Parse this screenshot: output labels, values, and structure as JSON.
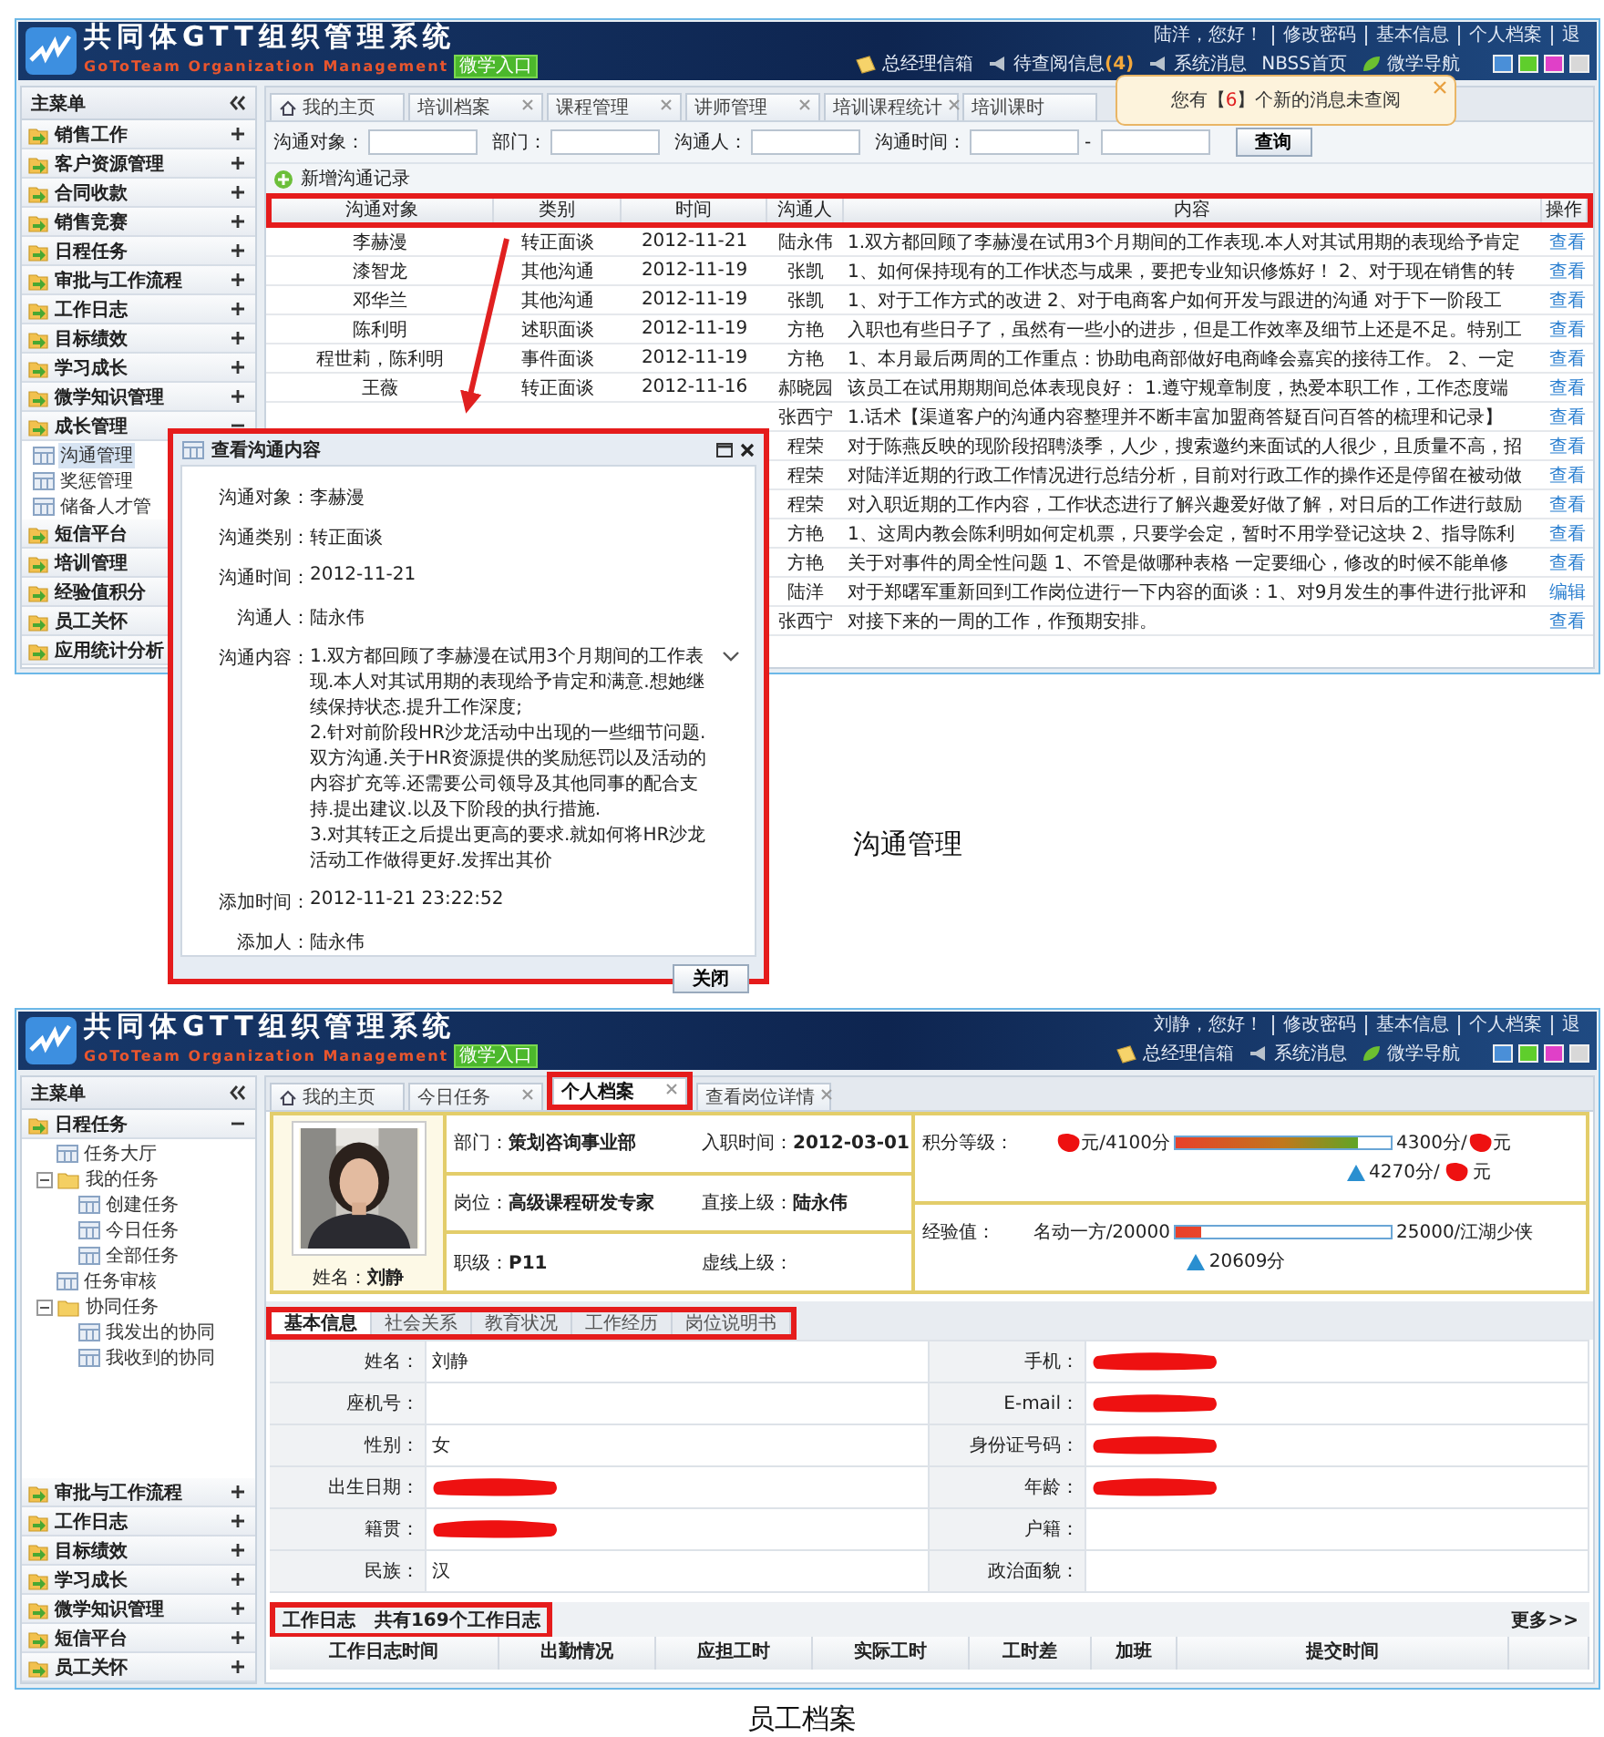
{
  "communication": {
    "caption": "沟通管理",
    "header": {
      "title": "共同体GTT组织管理系统",
      "subtitle": "GoToTeam Organization Management",
      "badge": "微学入口",
      "user_links": [
        "陆洋，您好！",
        "修改密码",
        "基本信息",
        "个人档案",
        "退"
      ],
      "tools": [
        {
          "kind": "mail",
          "label": "总经理信箱"
        },
        {
          "kind": "notice",
          "label": "待查阅信息",
          "count": "(4)"
        },
        {
          "kind": "system",
          "label": "系统消息"
        },
        {
          "kind": "link",
          "label": "NBSS首页"
        },
        {
          "kind": "guide",
          "label": "微学导航"
        }
      ]
    },
    "sidebar": {
      "title": "主菜单",
      "items": [
        {
          "label": "销售工作",
          "expanded": false
        },
        {
          "label": "客户资源管理",
          "expanded": false
        },
        {
          "label": "合同收款",
          "expanded": false
        },
        {
          "label": "销售竞赛",
          "expanded": false
        },
        {
          "label": "日程任务",
          "expanded": false
        },
        {
          "label": "审批与工作流程",
          "expanded": false
        },
        {
          "label": "工作日志",
          "expanded": false
        },
        {
          "label": "目标绩效",
          "expanded": false
        },
        {
          "label": "学习成长",
          "expanded": false
        },
        {
          "label": "微学知识管理",
          "expanded": false
        },
        {
          "label": "成长管理",
          "expanded": true,
          "children": [
            {
              "kind": "page",
              "label": "沟通管理",
              "selected": true
            },
            {
              "kind": "page",
              "label": "奖惩管理",
              "selected": false
            },
            {
              "kind": "page",
              "label": "储备人才管",
              "selected": false
            }
          ]
        },
        {
          "label": "短信平台"
        },
        {
          "label": "培训管理"
        },
        {
          "label": "经验值积分"
        },
        {
          "label": "员工关怀"
        },
        {
          "label": "应用统计分析"
        }
      ]
    },
    "tabs": [
      {
        "kind": "home",
        "label": "我的主页",
        "selected": false
      },
      {
        "kind": "closable",
        "label": "培训档案",
        "selected": false
      },
      {
        "kind": "closable",
        "label": "课程管理",
        "selected": false
      },
      {
        "kind": "closable",
        "label": "讲师管理",
        "selected": false
      },
      {
        "kind": "closable",
        "label": "培训课程统计",
        "selected": false
      },
      {
        "kind": "plain",
        "label": "培训课时",
        "selected": false
      }
    ],
    "notification": {
      "before": "您有【",
      "count": "6",
      "after": "】个新的消息未查阅"
    },
    "search": {
      "fields": [
        {
          "kind": "single",
          "label": "沟通对象："
        },
        {
          "kind": "single",
          "label": "部门："
        },
        {
          "kind": "single",
          "label": "沟通人："
        },
        {
          "kind": "range",
          "label": "沟通时间：",
          "separator": "-"
        }
      ],
      "button": "查询"
    },
    "add_link": "新增沟通记录",
    "table": {
      "header_highlighted": true,
      "columns": [
        "沟通对象",
        "类别",
        "时间",
        "沟通人",
        "内容",
        "操作"
      ],
      "rows": [
        {
          "target": "李赫漫",
          "type": "转正面谈",
          "date": "2012-11-21",
          "person": "陆永伟",
          "content": "1.双方都回顾了李赫漫在试用3个月期间的工作表现.本人对其试用期的表现给予肯定",
          "action": "查看"
        },
        {
          "target": "漆智龙",
          "type": "其他沟通",
          "date": "2012-11-19",
          "person": "张凯",
          "content": "1、如何保持现有的工作状态与成果，要把专业知识修炼好！ 2、对于现在销售的转",
          "action": "查看"
        },
        {
          "target": "邓华兰",
          "type": "其他沟通",
          "date": "2012-11-19",
          "person": "张凯",
          "content": "1、对于工作方式的改进 2、对于电商客户如何开发与跟进的沟通 对于下一阶段工",
          "action": "查看"
        },
        {
          "target": "陈利明",
          "type": "述职面谈",
          "date": "2012-11-19",
          "person": "方艳",
          "content": "入职也有些日子了，虽然有一些小的进步，但是工作效率及细节上还是不足。特别工",
          "action": "查看"
        },
        {
          "target": "程世莉，陈利明",
          "type": "事件面谈",
          "date": "2012-11-19",
          "person": "方艳",
          "content": "1、本月最后两周的工作重点：协助电商部做好电商峰会嘉宾的接待工作。 2、一定",
          "action": "查看"
        },
        {
          "target": "王薇",
          "type": "转正面谈",
          "date": "2012-11-16",
          "person": "郝晓园",
          "content": "该员工在试用期期间总体表现良好： 1.遵守规章制度，热爱本职工作，工作态度端",
          "action": "查看"
        },
        {
          "person": "张西宁",
          "content": "1.话术【渠道客户的沟通内容整理并不断丰富加盟商答疑百问百答的梳理和记录】",
          "action": "查看"
        },
        {
          "person": "程荣",
          "content": "对于陈燕反映的现阶段招聘淡季，人少，搜索邀约来面试的人很少，且质量不高，招",
          "action": "查看"
        },
        {
          "person": "程荣",
          "content": "对陆洋近期的行政工作情况进行总结分析，目前对行政工作的操作还是停留在被动做",
          "action": "查看"
        },
        {
          "person": "程荣",
          "content": "对入职近期的工作内容，工作状态进行了解兴趣爱好做了解，对日后的工作进行鼓励",
          "action": "查看"
        },
        {
          "person": "方艳",
          "content": "1、这周内教会陈利明如何定机票，只要学会定，暂时不用学登记这块 2、指导陈利",
          "action": "查看"
        },
        {
          "person": "方艳",
          "content": "关于对事件的周全性问题 1、不管是做哪种表格 一定要细心，修改的时候不能单修",
          "action": "查看"
        },
        {
          "person": "陆洋",
          "content": "对于郑曙军重新回到工作岗位进行一下内容的面谈：1、对9月发生的事件进行批评和",
          "action": "编辑"
        },
        {
          "person": "张西宁",
          "content": "对接下来的一周的工作，作预期安排。",
          "action": "查看"
        }
      ]
    },
    "dialog": {
      "title": "查看沟通内容",
      "highlighted": true,
      "fields": [
        {
          "kind": "text",
          "label": "沟通对象：",
          "value": "李赫漫"
        },
        {
          "kind": "text",
          "label": "沟通类别：",
          "value": "转正面谈"
        },
        {
          "kind": "text",
          "label": "沟通时间：",
          "value": "2012-11-21"
        },
        {
          "kind": "text",
          "label": "沟通人：",
          "value": "陆永伟"
        },
        {
          "kind": "multiline",
          "label": "沟通内容：",
          "paragraphs": [
            "1.双方都回顾了李赫漫在试用3个月期间的工作表现.本人对其试用期的表现给予肯定和满意.想她继续保持状态.提升工作深度;",
            "2.针对前阶段HR沙龙活动中出现的一些细节问题.双方沟通.关于HR资源提供的奖励惩罚以及活动的内容扩充等.还需要公司领导及其他同事的配合支持.提出建议.以及下阶段的执行措施.",
            "3.对其转正之后提出更高的要求.就如何将HR沙龙活动工作做得更好.发挥出其价"
          ]
        },
        {
          "kind": "text",
          "label": "添加时间：",
          "value": "2012-11-21 23:22:52"
        },
        {
          "kind": "text",
          "label": "添加人：",
          "value": "陆永伟"
        }
      ],
      "button": "关闭"
    }
  },
  "profile": {
    "caption": "员工档案",
    "header": {
      "title": "共同体GTT组织管理系统",
      "subtitle": "GoToTeam Organization Management",
      "badge": "微学入口",
      "user_links": [
        "刘静，您好！",
        "修改密码",
        "基本信息",
        "个人档案",
        "退"
      ],
      "tools": [
        {
          "kind": "mail",
          "label": "总经理信箱"
        },
        {
          "kind": "system",
          "label": "系统消息"
        },
        {
          "kind": "guide",
          "label": "微学导航"
        }
      ]
    },
    "sidebar": {
      "title": "主菜单",
      "items": [
        {
          "label": "日程任务",
          "expanded": true,
          "children": [
            {
              "kind": "page",
              "label": "任务大厅",
              "selected": false
            },
            {
              "kind": "folder",
              "label": "我的任务",
              "expanded": true,
              "children": [
                {
                  "kind": "page",
                  "label": "创建任务",
                  "selected": false
                },
                {
                  "kind": "page",
                  "label": "今日任务",
                  "selected": false
                },
                {
                  "kind": "page",
                  "label": "全部任务",
                  "selected": false
                }
              ]
            },
            {
              "kind": "page",
              "label": "任务审核",
              "selected": false
            },
            {
              "kind": "folder",
              "label": "协同任务",
              "expanded": true,
              "children": [
                {
                  "kind": "page",
                  "label": "我发出的协同",
                  "selected": false
                },
                {
                  "kind": "page",
                  "label": "我收到的协同",
                  "selected": false
                }
              ]
            }
          ]
        },
        {
          "label": "审批与工作流程",
          "expanded": false
        },
        {
          "label": "工作日志",
          "expanded": false
        },
        {
          "label": "目标绩效",
          "expanded": false
        },
        {
          "label": "学习成长",
          "expanded": false
        },
        {
          "label": "微学知识管理",
          "expanded": false
        },
        {
          "label": "短信平台",
          "expanded": false
        },
        {
          "label": "员工关怀",
          "expanded": false
        }
      ]
    },
    "tabs": [
      {
        "kind": "home",
        "label": "我的主页",
        "selected": false,
        "highlighted": false
      },
      {
        "kind": "closable",
        "label": "今日任务",
        "selected": false,
        "highlighted": false
      },
      {
        "kind": "closable",
        "label": "个人档案",
        "selected": true,
        "highlighted": true
      },
      {
        "kind": "closable",
        "label": "查看岗位详情",
        "selected": false,
        "highlighted": false
      }
    ],
    "card": {
      "name_label": "姓名：",
      "name": "刘静",
      "fields": [
        {
          "label": "部门：",
          "value": "策划咨询事业部"
        },
        {
          "label": "入职时间：",
          "value": "2012-03-01"
        },
        {
          "label": "岗位：",
          "value": "高级课程研发专家"
        },
        {
          "label": "直接上级：",
          "value": "陆永伟"
        },
        {
          "label": "职级：",
          "value": "P11"
        },
        {
          "label": "虚线上级："
        }
      ],
      "meters": [
        {
          "kind": "points",
          "label": "积分等级：",
          "min": [
            {
              "redacted": true
            },
            {
              "text": "元/4100分"
            }
          ],
          "max": [
            {
              "text": "4300分/"
            },
            {
              "redacted": true
            },
            {
              "text": "元"
            }
          ],
          "level": 0.85,
          "current": [
            {
              "text": "4270分/"
            },
            {
              "redacted": true
            },
            {
              "text": "元"
            }
          ]
        },
        {
          "kind": "experience",
          "label": "经验值：",
          "min": [
            {
              "text": "名动一方/20000"
            }
          ],
          "max": [
            {
              "text": "25000/江湖少侠"
            }
          ],
          "level": 0.12,
          "current": [
            {
              "text": "20609分"
            }
          ]
        }
      ]
    },
    "subtabs": {
      "highlighted": true,
      "items": [
        {
          "label": "基本信息",
          "selected": true
        },
        {
          "label": "社会关系",
          "selected": false
        },
        {
          "label": "教育状况",
          "selected": false
        },
        {
          "label": "工作经历",
          "selected": false
        },
        {
          "label": "岗位说明书",
          "selected": false
        }
      ]
    },
    "form": [
      {
        "label": "姓名：",
        "value": "刘静"
      },
      {
        "label": "手机：",
        "redacted": true
      },
      {
        "label": "座机号："
      },
      {
        "label": "E-mail：",
        "redacted": true
      },
      {
        "label": "性别：",
        "value": "女"
      },
      {
        "label": "身份证号码：",
        "redacted": true
      },
      {
        "label": "出生日期：",
        "redacted": true
      },
      {
        "label": "年龄：",
        "redacted": true
      },
      {
        "label": "籍贯：",
        "redacted": true
      },
      {
        "label": "户籍："
      },
      {
        "label": "民族：",
        "value": "汉"
      },
      {
        "label": "政治面貌："
      }
    ],
    "worklog": {
      "title": "工作日志",
      "count_text": "共有169个工作日志",
      "highlighted": true,
      "more": "更多>>",
      "columns": [
        "工作日志时间",
        "出勤情况",
        "应担工时",
        "实际工时",
        "工时差",
        "加班",
        "提交时间"
      ]
    }
  }
}
